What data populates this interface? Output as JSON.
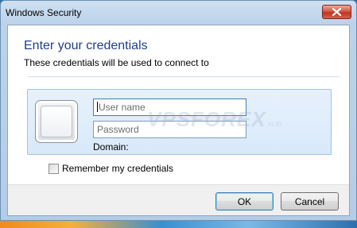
{
  "window": {
    "title": "Windows Security"
  },
  "dialog": {
    "heading": "Enter your credentials",
    "subheading": "These credentials will be used to connect to"
  },
  "credentials": {
    "username_placeholder": "User name",
    "password_placeholder": "Password",
    "domain_label": "Domain:"
  },
  "watermark": {
    "text": "VPSFOREX",
    "suffix": ".in.th"
  },
  "options": {
    "remember_label": "Remember my credentials",
    "remember_checked": false
  },
  "buttons": {
    "ok_label": "OK",
    "cancel_label": "Cancel"
  },
  "icons": {
    "close": "close-icon",
    "user_tile": "user-tile-icon"
  },
  "colors": {
    "heading": "#1e3e8f",
    "close_button": "#c0341e",
    "panel": "#d9e9fa"
  }
}
